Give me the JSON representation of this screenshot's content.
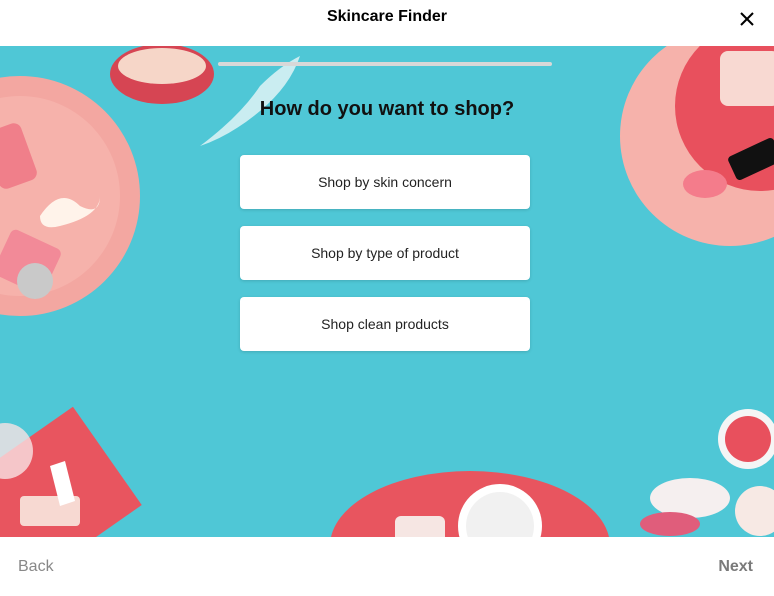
{
  "header": {
    "title": "Skincare Finder",
    "close_icon": "close-icon"
  },
  "quiz": {
    "progress_percent": 0,
    "question": "How do you want to shop?",
    "options": [
      {
        "label": "Shop by skin concern"
      },
      {
        "label": "Shop by type of product"
      },
      {
        "label": "Shop clean products"
      }
    ]
  },
  "footer": {
    "back_label": "Back",
    "next_label": "Next"
  },
  "colors": {
    "background": "#4fc7d6",
    "card": "#ffffff",
    "plate_pink": "#f2a09c",
    "plate_red": "#e8555f"
  }
}
